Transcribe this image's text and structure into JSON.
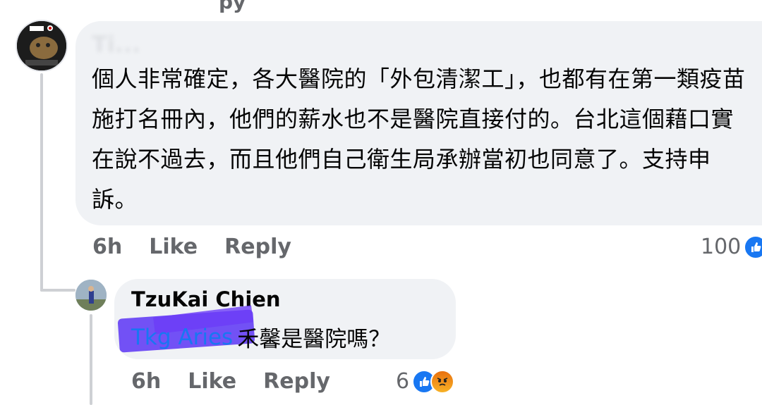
{
  "top_fragment": "py",
  "comment": {
    "author": "Ti...",
    "text": "個人非常確定，各大醫院的「外包清潔工」，也都有在第一類疫苗施打名冊內，他們的薪水也不是醫院直接付的。台北這個藉口實在說不過去，而且他們自己衛生局承辦當初也同意了。支持申訴。",
    "time": "6h",
    "like_label": "Like",
    "reply_label": "Reply",
    "reaction_count": "100",
    "reactions": [
      "like-icon"
    ]
  },
  "reply": {
    "author": "TzuKai Chien",
    "mention": "Tkg Aries",
    "text": "禾馨是醫院嗎？",
    "time": "6h",
    "like_label": "Like",
    "reply_label": "Reply",
    "reaction_count": "6",
    "reactions": [
      "like-icon",
      "angry-icon"
    ]
  },
  "colors": {
    "bubble": "#f0f2f5",
    "meta": "#65676b",
    "link": "#1877f2",
    "like": "#1877f2"
  }
}
